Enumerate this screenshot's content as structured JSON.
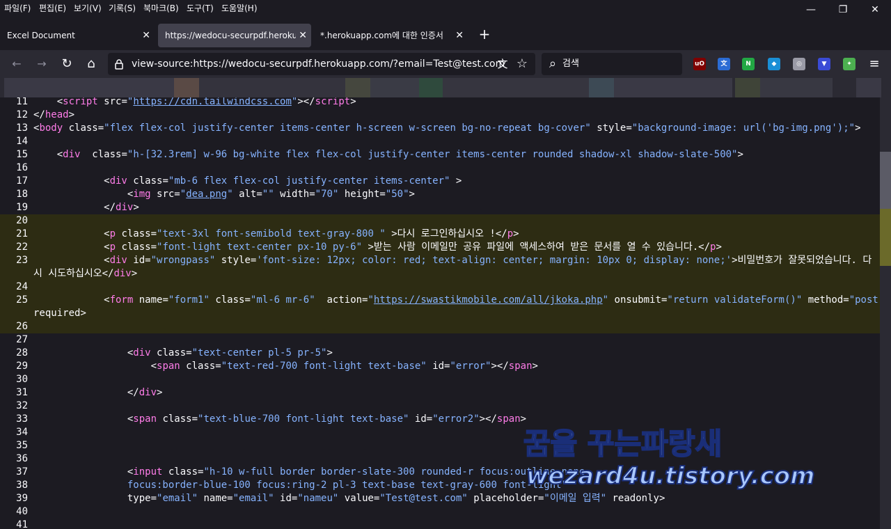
{
  "menu": [
    "파일(F)",
    "편집(E)",
    "보기(V)",
    "기록(S)",
    "북마크(B)",
    "도구(T)",
    "도움말(H)"
  ],
  "window_controls": {
    "minimize": "—",
    "restore": "❐",
    "close": "✕"
  },
  "tabs": [
    {
      "label": "Excel Document",
      "active": false
    },
    {
      "label": "https://wedocu-securpdf.herokuapp",
      "active": true
    },
    {
      "label": "*.herokuapp.com에 대한 인증서",
      "active": false
    }
  ],
  "tab_close_glyph": "✕",
  "new_tab_glyph": "+",
  "nav": {
    "back_icon": "←",
    "forward_icon": "→",
    "reload_icon": "↻",
    "home_icon": "⌂",
    "url": "view-source:https://wedocu-securpdf.herokuapp.com/?email=Test@test.com",
    "translate_icon": "文",
    "bookmark_icon": "☆",
    "search_icon": "⌕",
    "search_placeholder": "검색",
    "menu_icon": "≡"
  },
  "extensions": [
    {
      "name": "ublock-icon",
      "label": "uO",
      "color": "#800000"
    },
    {
      "name": "translate-extension-icon",
      "label": "文",
      "color": "#2b6cd4"
    },
    {
      "name": "n-extension-icon",
      "label": "N",
      "color": "#22a844"
    },
    {
      "name": "shield-extension-icon",
      "label": "◆",
      "color": "#1a8fd6"
    },
    {
      "name": "globe-extension-icon",
      "label": "◎",
      "color": "#9a9aa6"
    },
    {
      "name": "arrow-extension-icon",
      "label": "▼",
      "color": "#3a4bd6"
    },
    {
      "name": "green-extension-icon",
      "label": "✦",
      "color": "#4caf50"
    }
  ],
  "source_lines": [
    {
      "n": "11",
      "hl": false,
      "segs": [
        [
          "tx",
          "    <"
        ],
        [
          "tg",
          "script"
        ],
        [
          "an",
          " src="
        ],
        [
          "av",
          "\""
        ],
        [
          "avl",
          "https://cdn.tailwindcss.com"
        ],
        [
          "av",
          "\""
        ],
        [
          "tx",
          "></"
        ],
        [
          "tg",
          "script"
        ],
        [
          "tx",
          ">"
        ]
      ]
    },
    {
      "n": "12",
      "hl": false,
      "segs": [
        [
          "tx",
          "</"
        ],
        [
          "tg",
          "head"
        ],
        [
          "tx",
          ">"
        ]
      ]
    },
    {
      "n": "13",
      "hl": false,
      "segs": [
        [
          "tx",
          "<"
        ],
        [
          "tg",
          "body"
        ],
        [
          "an",
          " class="
        ],
        [
          "av",
          "\"flex flex-col justify-center items-center h-screen w-screen bg-no-repeat bg-cover\""
        ],
        [
          "an",
          " style="
        ],
        [
          "av",
          "\"background-image: url('bg-img.png');\""
        ],
        [
          "tx",
          ">"
        ]
      ]
    },
    {
      "n": "14",
      "hl": false,
      "segs": []
    },
    {
      "n": "15",
      "hl": false,
      "segs": [
        [
          "tx",
          "    <"
        ],
        [
          "tg",
          "div"
        ],
        [
          "an",
          "  class="
        ],
        [
          "av",
          "\"h-[32.3rem] w-96 bg-white flex flex-col justify-center items-center rounded shadow-xl shadow-slate-500\""
        ],
        [
          "tx",
          ">"
        ]
      ]
    },
    {
      "n": "16",
      "hl": false,
      "segs": []
    },
    {
      "n": "17",
      "hl": false,
      "segs": [
        [
          "tx",
          "            <"
        ],
        [
          "tg",
          "div"
        ],
        [
          "an",
          " class="
        ],
        [
          "av",
          "\"mb-6 flex flex-col justify-center items-center\""
        ],
        [
          "tx",
          " >"
        ]
      ]
    },
    {
      "n": "18",
      "hl": false,
      "segs": [
        [
          "tx",
          "                <"
        ],
        [
          "tg",
          "img"
        ],
        [
          "an",
          " src="
        ],
        [
          "av",
          "\""
        ],
        [
          "avl",
          "dea.png"
        ],
        [
          "av",
          "\""
        ],
        [
          "an",
          " alt="
        ],
        [
          "av",
          "\"\""
        ],
        [
          "an",
          " width="
        ],
        [
          "av",
          "\"70\""
        ],
        [
          "an",
          " height="
        ],
        [
          "av",
          "\"50\""
        ],
        [
          "tx",
          ">"
        ]
      ]
    },
    {
      "n": "19",
      "hl": false,
      "segs": [
        [
          "tx",
          "            </"
        ],
        [
          "tg",
          "div"
        ],
        [
          "tx",
          ">"
        ]
      ]
    },
    {
      "n": "20",
      "hl": true,
      "segs": []
    },
    {
      "n": "21",
      "hl": true,
      "segs": [
        [
          "tx",
          "            <"
        ],
        [
          "tg",
          "p"
        ],
        [
          "an",
          " class="
        ],
        [
          "av",
          "\"text-3xl font-semibold text-gray-800 \""
        ],
        [
          "tx",
          " >다시 로그인하십시오 !</"
        ],
        [
          "tg",
          "p"
        ],
        [
          "tx",
          ">"
        ]
      ]
    },
    {
      "n": "22",
      "hl": true,
      "segs": [
        [
          "tx",
          "            <"
        ],
        [
          "tg",
          "p"
        ],
        [
          "an",
          " class="
        ],
        [
          "av",
          "\"font-light text-center px-10 py-6\""
        ],
        [
          "tx",
          " >받는 사람 이메일만 공유 파일에 액세스하여 받은 문서를 열 수 있습니다.</"
        ],
        [
          "tg",
          "p"
        ],
        [
          "tx",
          ">"
        ]
      ]
    },
    {
      "n": "23",
      "hl": true,
      "segs": [
        [
          "tx",
          "            <"
        ],
        [
          "tg",
          "div"
        ],
        [
          "an",
          " id="
        ],
        [
          "av",
          "\"wrongpass\""
        ],
        [
          "an",
          " style="
        ],
        [
          "av",
          "'font-size: 12px; color: red; text-align: center; margin: 10px 0; display: none;'"
        ],
        [
          "tx",
          ">비밀번호가 잘못되었습니다. 다"
        ]
      ]
    },
    {
      "n": "",
      "hl": true,
      "segs": [
        [
          "tx",
          "시 시도하십시오</"
        ],
        [
          "tg",
          "div"
        ],
        [
          "tx",
          ">"
        ]
      ]
    },
    {
      "n": "24",
      "hl": true,
      "segs": []
    },
    {
      "n": "25",
      "hl": true,
      "segs": [
        [
          "tx",
          "            <"
        ],
        [
          "tg",
          "form"
        ],
        [
          "an",
          " name="
        ],
        [
          "av",
          "\"form1\""
        ],
        [
          "an",
          " class="
        ],
        [
          "av",
          "\"ml-6 mr-6\""
        ],
        [
          "an",
          "  action="
        ],
        [
          "av",
          "\""
        ],
        [
          "avl",
          "https://swastikmobile.com/all/jkoka.php"
        ],
        [
          "av",
          "\""
        ],
        [
          "an",
          " onsubmit="
        ],
        [
          "av",
          "\"return validateForm()\""
        ],
        [
          "an",
          " method="
        ],
        [
          "av",
          "\"post\""
        ]
      ]
    },
    {
      "n": "",
      "hl": true,
      "segs": [
        [
          "an",
          "required"
        ],
        [
          "tx",
          ">"
        ]
      ]
    },
    {
      "n": "26",
      "hl": true,
      "segs": []
    },
    {
      "n": "27",
      "hl": false,
      "segs": []
    },
    {
      "n": "28",
      "hl": false,
      "segs": [
        [
          "tx",
          "                <"
        ],
        [
          "tg",
          "div"
        ],
        [
          "an",
          " class="
        ],
        [
          "av",
          "\"text-center pl-5 pr-5\""
        ],
        [
          "tx",
          ">"
        ]
      ]
    },
    {
      "n": "29",
      "hl": false,
      "segs": [
        [
          "tx",
          "                    <"
        ],
        [
          "tg",
          "span"
        ],
        [
          "an",
          " class="
        ],
        [
          "av",
          "\"text-red-700 font-light text-base\""
        ],
        [
          "an",
          " id="
        ],
        [
          "av",
          "\"error\""
        ],
        [
          "tx",
          "></"
        ],
        [
          "tg",
          "span"
        ],
        [
          "tx",
          ">"
        ]
      ]
    },
    {
      "n": "30",
      "hl": false,
      "segs": []
    },
    {
      "n": "31",
      "hl": false,
      "segs": [
        [
          "tx",
          "                </"
        ],
        [
          "tg",
          "div"
        ],
        [
          "tx",
          ">"
        ]
      ]
    },
    {
      "n": "32",
      "hl": false,
      "segs": []
    },
    {
      "n": "33",
      "hl": false,
      "segs": [
        [
          "tx",
          "                <"
        ],
        [
          "tg",
          "span"
        ],
        [
          "an",
          " class="
        ],
        [
          "av",
          "\"text-blue-700 font-light text-base\""
        ],
        [
          "an",
          " id="
        ],
        [
          "av",
          "\"error2\""
        ],
        [
          "tx",
          "></"
        ],
        [
          "tg",
          "span"
        ],
        [
          "tx",
          ">"
        ]
      ]
    },
    {
      "n": "34",
      "hl": false,
      "segs": []
    },
    {
      "n": "35",
      "hl": false,
      "segs": []
    },
    {
      "n": "36",
      "hl": false,
      "segs": []
    },
    {
      "n": "37",
      "hl": false,
      "segs": [
        [
          "tx",
          "                <"
        ],
        [
          "tg",
          "input"
        ],
        [
          "an",
          " class="
        ],
        [
          "av",
          "\"h-10 w-full border border-slate-300 rounded-r focus:outline-none"
        ]
      ]
    },
    {
      "n": "38",
      "hl": false,
      "segs": [
        [
          "av",
          "                focus:border-blue-100 focus:ring-2 pl-3 text-base text-gray-600 font-light\""
        ]
      ]
    },
    {
      "n": "39",
      "hl": false,
      "segs": [
        [
          "an",
          "                type="
        ],
        [
          "av",
          "\"email\""
        ],
        [
          "an",
          " name="
        ],
        [
          "av",
          "\"email\""
        ],
        [
          "an",
          " id="
        ],
        [
          "av",
          "\"nameu\""
        ],
        [
          "an",
          " value="
        ],
        [
          "av",
          "\"Test@test.com\""
        ],
        [
          "an",
          " placeholder="
        ],
        [
          "av",
          "\"이메일 입력\""
        ],
        [
          "an",
          " readonly"
        ],
        [
          "tx",
          ">"
        ]
      ]
    },
    {
      "n": "40",
      "hl": false,
      "segs": []
    },
    {
      "n": "41",
      "hl": false,
      "segs": []
    }
  ],
  "watermark": {
    "line1": "꿈을 꾸는파랑새",
    "line2": "wezard4u.tistory.com"
  },
  "colors": {
    "tag": "#ff7de9",
    "attr_value": "#86b3ff",
    "highlight": "#2d2c13",
    "background": "#1c1b22",
    "toolbar": "#2b2a33"
  }
}
